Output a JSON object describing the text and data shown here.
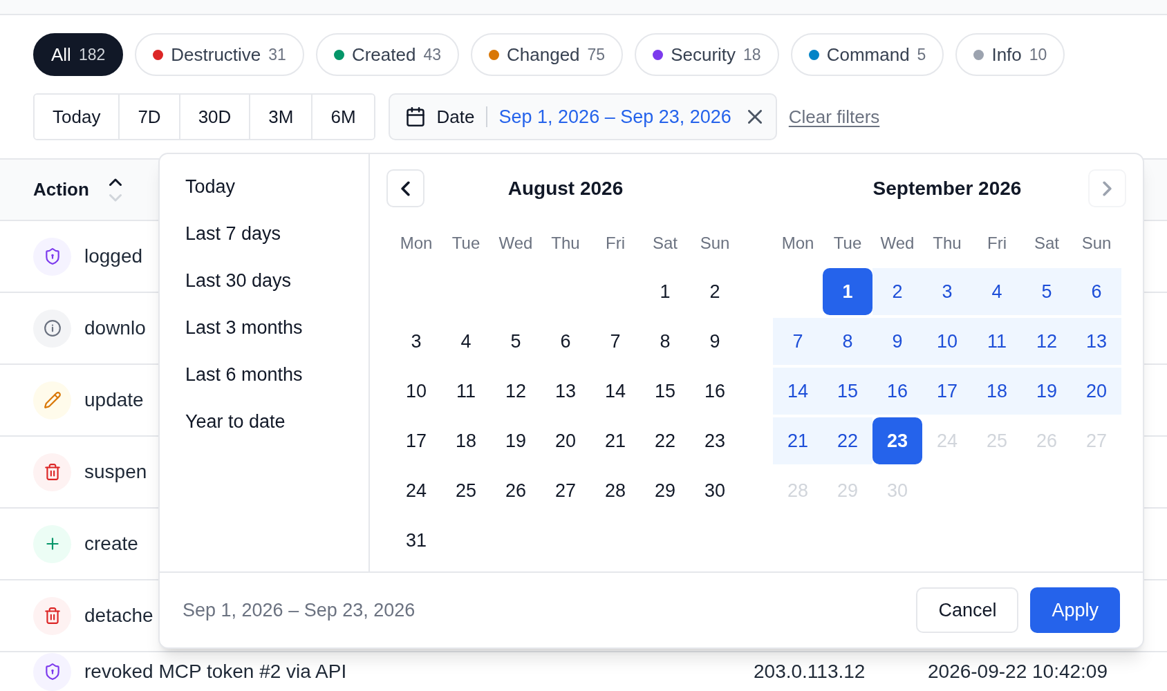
{
  "category_chips": [
    {
      "label": "All",
      "count": "182",
      "selected": true
    },
    {
      "label": "Destructive",
      "count": "31",
      "color": "#dc2626",
      "selected": false
    },
    {
      "label": "Created",
      "count": "43",
      "color": "#059669",
      "selected": false
    },
    {
      "label": "Changed",
      "count": "75",
      "color": "#d97706",
      "selected": false
    },
    {
      "label": "Security",
      "count": "18",
      "color": "#7c3aed",
      "selected": false
    },
    {
      "label": "Command",
      "count": "5",
      "color": "#0284c7",
      "selected": false
    },
    {
      "label": "Info",
      "count": "10",
      "color": "#9ca3af",
      "selected": false
    }
  ],
  "range_buttons": [
    {
      "label": "Today",
      "selected": false
    },
    {
      "label": "7D",
      "selected": false
    },
    {
      "label": "30D",
      "selected": false
    },
    {
      "label": "3M",
      "selected": false
    },
    {
      "label": "6M",
      "selected": false
    }
  ],
  "date_filter": {
    "label": "Date",
    "value": "Sep 1, 2026 – Sep 23, 2026"
  },
  "clear_filters": "Clear filters",
  "table": {
    "columns": [
      {
        "label": "Action",
        "sorted": true,
        "ascending": true
      }
    ],
    "rows": [
      {
        "kind": "security",
        "action": "logged"
      },
      {
        "kind": "info",
        "action": "downlo"
      },
      {
        "kind": "changed",
        "action": "update"
      },
      {
        "kind": "destructive",
        "action": "suspen"
      },
      {
        "kind": "created",
        "action": "create"
      },
      {
        "kind": "destructive",
        "action": "detache"
      },
      {
        "kind": "security",
        "action": "revoked MCP token #2 via API",
        "ip": "203.0.113.12",
        "time": "2026-09-22 10:42:09"
      }
    ]
  },
  "date_picker": {
    "presets": [
      {
        "label": "Today",
        "selected": false
      },
      {
        "label": "Last 7 days",
        "selected": false
      },
      {
        "label": "Last 30 days",
        "selected": false
      },
      {
        "label": "Last 3 months",
        "selected": false
      },
      {
        "label": "Last 6 months",
        "selected": false
      },
      {
        "label": "Year to date",
        "selected": false
      }
    ],
    "prev_button": {
      "disabled": false
    },
    "next_button": {
      "disabled": true
    },
    "months": [
      {
        "title": "August 2026",
        "weekdays": [
          "Mon",
          "Tue",
          "Wed",
          "Thu",
          "Fri",
          "Sat",
          "Sun"
        ],
        "weeks": [
          [
            {
              "label": "1",
              "selected": false,
              "in_range": false,
              "disabled": false
            },
            {
              "label": "2",
              "selected": false,
              "in_range": false,
              "disabled": false
            }
          ],
          [
            {
              "label": "3",
              "selected": false,
              "in_range": false,
              "disabled": false
            },
            {
              "label": "4",
              "selected": false,
              "in_range": false,
              "disabled": false
            },
            {
              "label": "5",
              "selected": false,
              "in_range": false,
              "disabled": false
            },
            {
              "label": "6",
              "selected": false,
              "in_range": false,
              "disabled": false
            },
            {
              "label": "7",
              "selected": false,
              "in_range": false,
              "disabled": false
            },
            {
              "label": "8",
              "selected": false,
              "in_range": false,
              "disabled": false
            },
            {
              "label": "9",
              "selected": false,
              "in_range": false,
              "disabled": false
            }
          ],
          [
            {
              "label": "10",
              "selected": false,
              "in_range": false,
              "disabled": false
            },
            {
              "label": "11",
              "selected": false,
              "in_range": false,
              "disabled": false
            },
            {
              "label": "12",
              "selected": false,
              "in_range": false,
              "disabled": false
            },
            {
              "label": "13",
              "selected": false,
              "in_range": false,
              "disabled": false
            },
            {
              "label": "14",
              "selected": false,
              "in_range": false,
              "disabled": false
            },
            {
              "label": "15",
              "selected": false,
              "in_range": false,
              "disabled": false
            },
            {
              "label": "16",
              "selected": false,
              "in_range": false,
              "disabled": false
            }
          ],
          [
            {
              "label": "17",
              "selected": false,
              "in_range": false,
              "disabled": false
            },
            {
              "label": "18",
              "selected": false,
              "in_range": false,
              "disabled": false
            },
            {
              "label": "19",
              "selected": false,
              "in_range": false,
              "disabled": false
            },
            {
              "label": "20",
              "selected": false,
              "in_range": false,
              "disabled": false
            },
            {
              "label": "21",
              "selected": false,
              "in_range": false,
              "disabled": false
            },
            {
              "label": "22",
              "selected": false,
              "in_range": false,
              "disabled": false
            },
            {
              "label": "23",
              "selected": false,
              "in_range": false,
              "disabled": false
            }
          ],
          [
            {
              "label": "24",
              "selected": false,
              "in_range": false,
              "disabled": false
            },
            {
              "label": "25",
              "selected": false,
              "in_range": false,
              "disabled": false
            },
            {
              "label": "26",
              "selected": false,
              "in_range": false,
              "disabled": false
            },
            {
              "label": "27",
              "selected": false,
              "in_range": false,
              "disabled": false
            },
            {
              "label": "28",
              "selected": false,
              "in_range": false,
              "disabled": false
            },
            {
              "label": "29",
              "selected": false,
              "in_range": false,
              "disabled": false
            },
            {
              "label": "30",
              "selected": false,
              "in_range": false,
              "disabled": false
            }
          ],
          [
            {
              "label": "31",
              "selected": false,
              "in_range": false,
              "disabled": false
            }
          ]
        ]
      },
      {
        "title": "September 2026",
        "weekdays": [
          "Mon",
          "Tue",
          "Wed",
          "Thu",
          "Fri",
          "Sat",
          "Sun"
        ],
        "weeks": [
          [
            {
              "label": "1",
              "selected": true,
              "in_range": false,
              "disabled": false
            },
            {
              "label": "2",
              "selected": false,
              "in_range": true,
              "disabled": false
            },
            {
              "label": "3",
              "selected": false,
              "in_range": true,
              "disabled": false
            },
            {
              "label": "4",
              "selected": false,
              "in_range": true,
              "disabled": false
            },
            {
              "label": "5",
              "selected": false,
              "in_range": true,
              "disabled": false
            },
            {
              "label": "6",
              "selected": false,
              "in_range": true,
              "disabled": false
            }
          ],
          [
            {
              "label": "7",
              "selected": false,
              "in_range": true,
              "disabled": false
            },
            {
              "label": "8",
              "selected": false,
              "in_range": true,
              "disabled": false
            },
            {
              "label": "9",
              "selected": false,
              "in_range": true,
              "disabled": false
            },
            {
              "label": "10",
              "selected": false,
              "in_range": true,
              "disabled": false
            },
            {
              "label": "11",
              "selected": false,
              "in_range": true,
              "disabled": false
            },
            {
              "label": "12",
              "selected": false,
              "in_range": true,
              "disabled": false
            },
            {
              "label": "13",
              "selected": false,
              "in_range": true,
              "disabled": false
            }
          ],
          [
            {
              "label": "14",
              "selected": false,
              "in_range": true,
              "disabled": false
            },
            {
              "label": "15",
              "selected": false,
              "in_range": true,
              "disabled": false
            },
            {
              "label": "16",
              "selected": false,
              "in_range": true,
              "disabled": false
            },
            {
              "label": "17",
              "selected": false,
              "in_range": true,
              "disabled": false
            },
            {
              "label": "18",
              "selected": false,
              "in_range": true,
              "disabled": false
            },
            {
              "label": "19",
              "selected": false,
              "in_range": true,
              "disabled": false
            },
            {
              "label": "20",
              "selected": false,
              "in_range": true,
              "disabled": false
            }
          ],
          [
            {
              "label": "21",
              "selected": false,
              "in_range": true,
              "disabled": false
            },
            {
              "label": "22",
              "selected": false,
              "in_range": true,
              "disabled": false
            },
            {
              "label": "23",
              "selected": true,
              "in_range": false,
              "disabled": false
            },
            {
              "label": "24",
              "selected": false,
              "in_range": false,
              "disabled": true
            },
            {
              "label": "25",
              "selected": false,
              "in_range": false,
              "disabled": true
            },
            {
              "label": "26",
              "selected": false,
              "in_range": false,
              "disabled": true
            },
            {
              "label": "27",
              "selected": false,
              "in_range": false,
              "disabled": true
            }
          ],
          [
            {
              "label": "28",
              "selected": false,
              "in_range": false,
              "disabled": true
            },
            {
              "label": "29",
              "selected": false,
              "in_range": false,
              "disabled": true
            },
            {
              "label": "30",
              "selected": false,
              "in_range": false,
              "disabled": true
            }
          ]
        ]
      }
    ],
    "summary": "Sep 1, 2026 – Sep 23, 2026",
    "buttons": [
      {
        "label": "Cancel",
        "kind": "secondary"
      },
      {
        "label": "Apply",
        "kind": "primary"
      }
    ]
  }
}
